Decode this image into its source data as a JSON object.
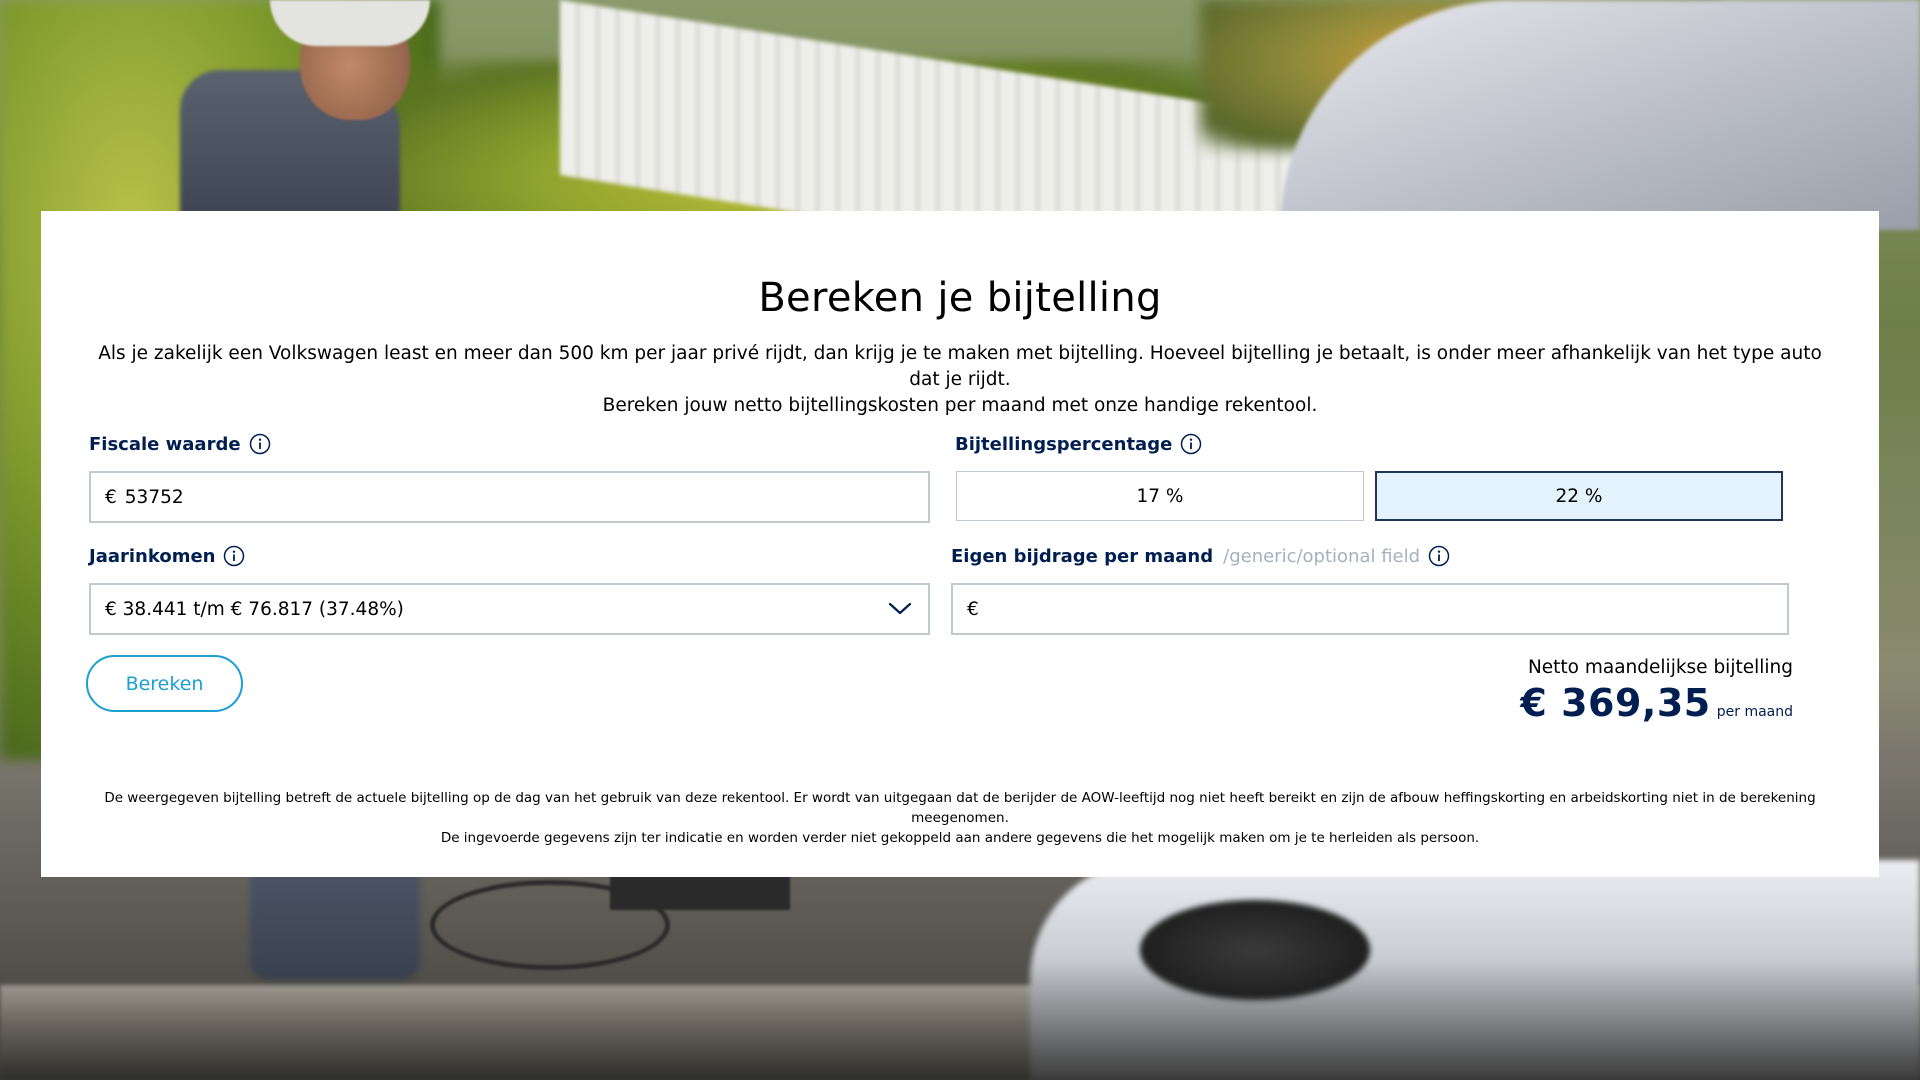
{
  "calculator": {
    "title": "Bereken je bijtelling",
    "intro_line_1": "Als je zakelijk een Volkswagen least en meer dan 500 km per jaar privé rijdt, dan krijg je te maken met bijtelling. Hoeveel bijtelling je betaalt, is onder meer afhankelijk van het type auto dat je rijdt.",
    "intro_line_2": "Bereken jouw netto bijtellingskosten per maand met onze handige rekentool.",
    "fiscal_value": {
      "label": "Fiscale waarde",
      "currency": "€",
      "value": "53752",
      "info_icon": "info-icon"
    },
    "percentage": {
      "label": "Bijtellingspercentage",
      "info_icon": "info-icon",
      "options": [
        {
          "label": "17 %",
          "selected": false
        },
        {
          "label": "22 %",
          "selected": true
        }
      ]
    },
    "annual_income": {
      "label": "Jaarinkomen",
      "info_icon": "info-icon",
      "selected": "€ 38.441 t/m € 76.817 (37.48%)",
      "chevron_icon": "chevron-down-icon"
    },
    "contribution": {
      "label": "Eigen bijdrage per maand",
      "optional_hint": "/generic/optional field",
      "info_icon": "info-icon",
      "currency": "€",
      "value": ""
    },
    "calculate_button": "Bereken",
    "result": {
      "label": "Netto maandelijkse bijtelling",
      "amount": "€ 369,35",
      "unit": "per maand"
    },
    "disclaimer_line_1": "De weergegeven bijtelling betreft de actuele bijtelling op de dag van het gebruik van deze rekentool. Er wordt van uitgegaan dat de berijder de AOW-leeftijd nog niet heeft bereikt en zijn de afbouw heffingskorting en arbeidskorting niet in de berekening meegenomen.",
    "disclaimer_line_2": "De ingevoerde gegevens zijn ter indicatie en worden verder niet gekoppeld aan andere gegevens die het mogelijk maken om je te herleiden als persoon."
  },
  "colors": {
    "brand_navy": "#001e50",
    "accent_blue": "#1c9fd1",
    "selected_fill": "#e4f3fd",
    "field_border": "#c2cacf",
    "hint_grey": "#a6b0bd"
  }
}
